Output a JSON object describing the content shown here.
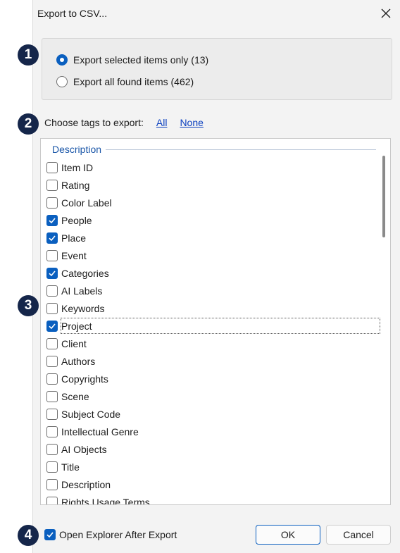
{
  "dialog": {
    "title": "Export to CSV..."
  },
  "export_scope": {
    "options": [
      {
        "label": "Export selected items only (13)",
        "selected": true
      },
      {
        "label": "Export all found items (462)",
        "selected": false
      }
    ]
  },
  "tags": {
    "choose_label": "Choose tags to export:",
    "all_link": "All",
    "none_link": "None",
    "group_header": "Description",
    "items": [
      {
        "label": "Item ID",
        "checked": false
      },
      {
        "label": "Rating",
        "checked": false
      },
      {
        "label": "Color Label",
        "checked": false
      },
      {
        "label": "People",
        "checked": true
      },
      {
        "label": "Place",
        "checked": true
      },
      {
        "label": "Event",
        "checked": false
      },
      {
        "label": "Categories",
        "checked": true
      },
      {
        "label": "AI Labels",
        "checked": false
      },
      {
        "label": "Keywords",
        "checked": false
      },
      {
        "label": "Project",
        "checked": true,
        "focused": true
      },
      {
        "label": "Client",
        "checked": false
      },
      {
        "label": "Authors",
        "checked": false
      },
      {
        "label": "Copyrights",
        "checked": false
      },
      {
        "label": "Scene",
        "checked": false
      },
      {
        "label": "Subject Code",
        "checked": false
      },
      {
        "label": "Intellectual Genre",
        "checked": false
      },
      {
        "label": "AI Objects",
        "checked": false
      },
      {
        "label": "Title",
        "checked": false
      },
      {
        "label": "Description",
        "checked": false
      },
      {
        "label": "Rights Usage Terms",
        "checked": false
      }
    ]
  },
  "footer": {
    "open_explorer_label": "Open Explorer After Export",
    "open_explorer_checked": true,
    "ok_label": "OK",
    "cancel_label": "Cancel"
  },
  "badges": [
    "1",
    "2",
    "3",
    "4"
  ],
  "colors": {
    "accent": "#0a5fbf",
    "badge": "#15264a",
    "link": "#0a3fbf"
  },
  "icons": {
    "close": "close-icon",
    "checkmark": "checkmark-icon"
  }
}
